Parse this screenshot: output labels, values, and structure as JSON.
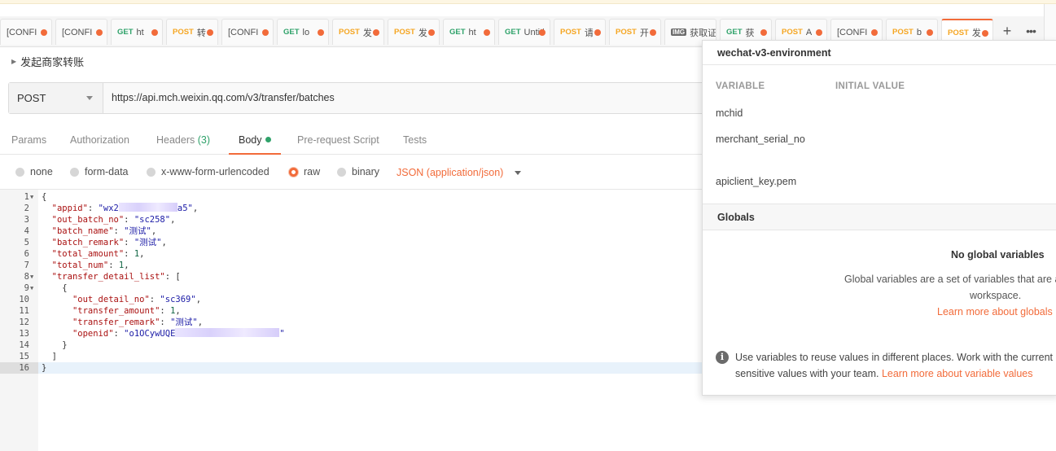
{
  "tabs": [
    {
      "method": "",
      "label": "[CONFI",
      "type": "none"
    },
    {
      "method": "",
      "label": "[CONFI",
      "type": "none"
    },
    {
      "method": "GET",
      "label": "ht",
      "type": "get"
    },
    {
      "method": "POST",
      "label": "转",
      "type": "post"
    },
    {
      "method": "",
      "label": "[CONFI",
      "type": "none"
    },
    {
      "method": "GET",
      "label": "lo",
      "type": "get"
    },
    {
      "method": "POST",
      "label": "发",
      "type": "post"
    },
    {
      "method": "POST",
      "label": "发",
      "type": "post"
    },
    {
      "method": "GET",
      "label": "ht",
      "type": "get"
    },
    {
      "method": "GET",
      "label": "Untitl",
      "type": "get"
    },
    {
      "method": "POST",
      "label": "请",
      "type": "post"
    },
    {
      "method": "POST",
      "label": "开",
      "type": "post"
    },
    {
      "method": "IMG",
      "label": "获取证",
      "type": "img"
    },
    {
      "method": "GET",
      "label": "获",
      "type": "get"
    },
    {
      "method": "POST",
      "label": "A",
      "type": "post"
    },
    {
      "method": "",
      "label": "[CONFI",
      "type": "none"
    },
    {
      "method": "POST",
      "label": "b",
      "type": "post"
    },
    {
      "method": "POST",
      "label": "发",
      "type": "post"
    }
  ],
  "tab_controls": {
    "add": "+",
    "more": "•••"
  },
  "request": {
    "name": "发起商家转账",
    "method": "POST",
    "url": "https://api.mch.weixin.qq.com/v3/transfer/batches"
  },
  "subtabs": {
    "params": "Params",
    "authorization": "Authorization",
    "headers": "Headers",
    "headers_count": "(3)",
    "body": "Body",
    "prerequest": "Pre-request Script",
    "tests": "Tests"
  },
  "body_types": {
    "none": "none",
    "form_data": "form-data",
    "urlencoded": "x-www-form-urlencoded",
    "raw": "raw",
    "binary": "binary",
    "content_type": "JSON (application/json)"
  },
  "code": {
    "line_numbers": [
      "1",
      "2",
      "3",
      "4",
      "5",
      "6",
      "7",
      "8",
      "9",
      "10",
      "11",
      "12",
      "13",
      "14",
      "15",
      "16"
    ],
    "l1": "{",
    "l2_key": "\"appid\"",
    "l2_pre": "\"wx2",
    "l2_post": "a5\"",
    "l3_key": "\"out_batch_no\"",
    "l3_val": "\"sc258\"",
    "l4_key": "\"batch_name\"",
    "l4_val": "\"测试\"",
    "l5_key": "\"batch_remark\"",
    "l5_val": "\"测试\"",
    "l6_key": "\"total_amount\"",
    "l6_val": "1",
    "l7_key": "\"total_num\"",
    "l7_val": "1",
    "l8_key": "\"transfer_detail_list\"",
    "l8_rest": "[",
    "l9": "{",
    "l10_key": "\"out_detail_no\"",
    "l10_val": "\"sc369\"",
    "l11_key": "\"transfer_amount\"",
    "l11_val": "1",
    "l12_key": "\"transfer_remark\"",
    "l12_val": "\"测试\"",
    "l13_key": "\"openid\"",
    "l13_pre": "\"o1OCywUQE",
    "l13_post": "\"",
    "l14": "}",
    "l15": "]",
    "l16": "}"
  },
  "environment": {
    "name": "wechat-v3-environment",
    "col_variable": "VARIABLE",
    "col_initial": "INITIAL VALUE",
    "vars": [
      "mchid",
      "merchant_serial_no",
      "apiclient_key.pem"
    ]
  },
  "globals": {
    "title": "Globals",
    "empty_title": "No global variables",
    "desc_line1": "Global variables are a set of variables that are a",
    "desc_line2": "workspace.",
    "link": "Learn more about globals"
  },
  "tip": {
    "icon": "info-icon",
    "line1": "Use variables to reuse values in different places. Work with the current",
    "line2": "sensitive values with your team.",
    "link": "Learn more about variable values"
  },
  "colors": {
    "accent": "#f26b3a",
    "get": "#2fa26a",
    "post": "#f5a623"
  }
}
